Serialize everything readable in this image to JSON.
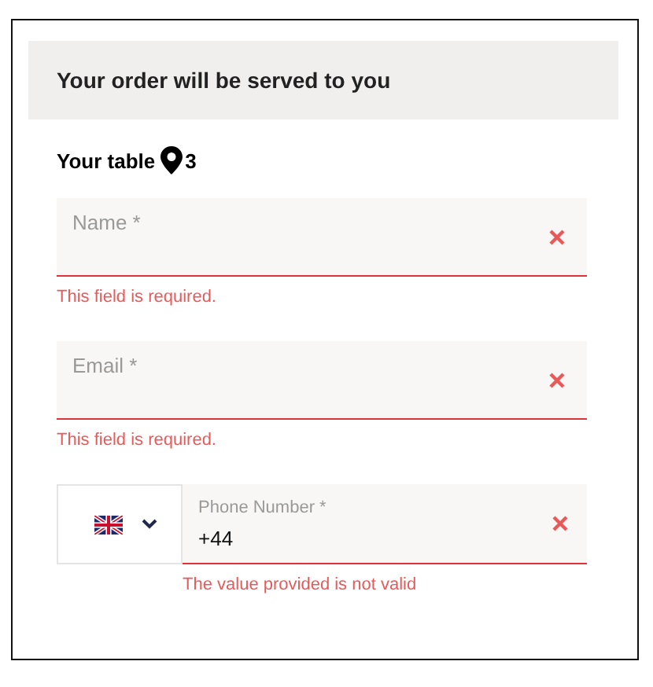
{
  "header": {
    "title": "Your order will be served to you"
  },
  "table": {
    "label": "Your table",
    "number": "3"
  },
  "fields": [
    {
      "kind": "text",
      "placeholder": "Name *",
      "error": "This field is required.",
      "invalid": true
    },
    {
      "kind": "text",
      "placeholder": "Email *",
      "error": "This field is required.",
      "invalid": true
    },
    {
      "kind": "phone",
      "label": "Phone Number *",
      "value": "+44",
      "error": "The value provided is not valid",
      "invalid": true
    }
  ]
}
